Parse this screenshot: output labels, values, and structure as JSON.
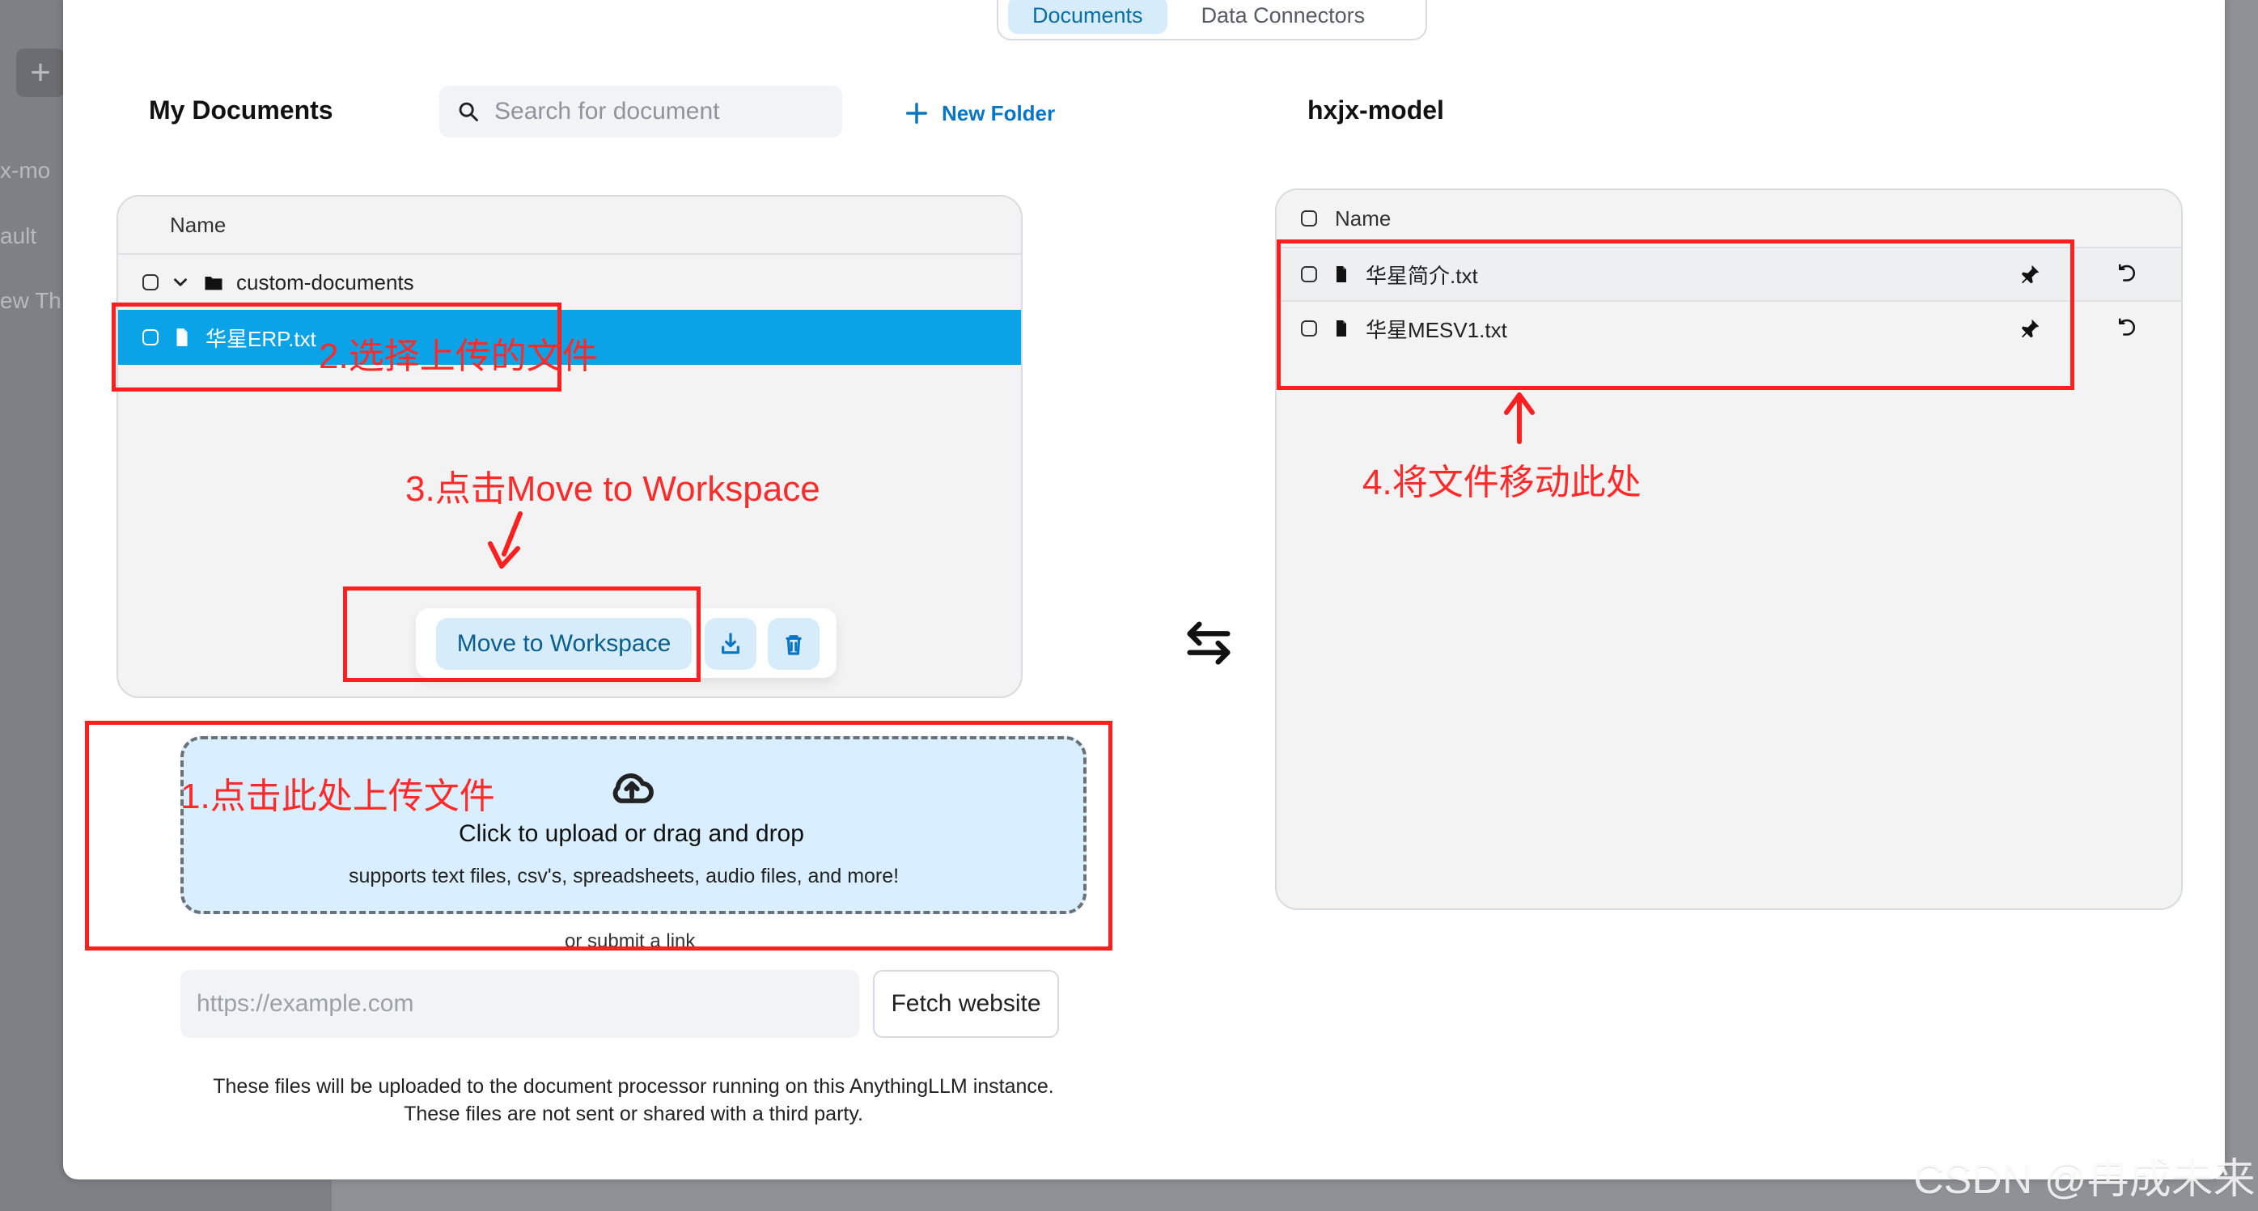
{
  "background": {
    "sidebar_plus": "+",
    "sidebar_text_1": "x-mo",
    "sidebar_text_2": "ault",
    "sidebar_text_3": "ew Th"
  },
  "tabs": [
    {
      "label": "Documents",
      "active": true
    },
    {
      "label": "Data Connectors",
      "active": false
    }
  ],
  "left": {
    "title": "My Documents",
    "search": {
      "placeholder": "Search for document"
    },
    "new_folder_label": "New Folder",
    "table_header": "Name",
    "folder": {
      "name": "custom-documents"
    },
    "selected_file": {
      "name": "华星ERP.txt"
    },
    "actions": {
      "move_label": "Move to Workspace"
    }
  },
  "upload": {
    "title": "Click to upload or drag and drop",
    "subtitle": "supports text files, csv's, spreadsheets, audio files, and more!",
    "or_submit_link": "or submit a link",
    "url_placeholder": "https://example.com",
    "fetch_label": "Fetch website",
    "disclaimer_line1": "These files will be uploaded to the document processor running on this AnythingLLM instance.",
    "disclaimer_line2": "These files are not sent or shared with a third party."
  },
  "right": {
    "workspace_title": "hxjx-model",
    "table_header": "Name",
    "files": [
      {
        "name": "华星简介.txt"
      },
      {
        "name": "华星MESV1.txt"
      }
    ]
  },
  "annotations": {
    "a1": "1.点击此处上传文件",
    "a2": "2.选择上传的文件",
    "a3": "3.点击Move to Workspace",
    "a4": "4.将文件移动此处"
  },
  "watermark": "CSDN @冉成未来",
  "icons": {
    "close": "×",
    "swap": "swap-arrows",
    "search": "search-icon",
    "plus": "plus-icon",
    "folder": "folder-icon",
    "file": "file-icon",
    "pin": "pin-icon",
    "undo": "undo-icon",
    "cloud_upload": "cloud-upload-icon",
    "download": "download-icon",
    "trash": "trash-icon"
  },
  "colors": {
    "accent_blue": "#0aa3e8",
    "annotation_red": "#ff1f1f",
    "modal_bg": "#ffffff",
    "overlay_bg": "#8f9196"
  }
}
